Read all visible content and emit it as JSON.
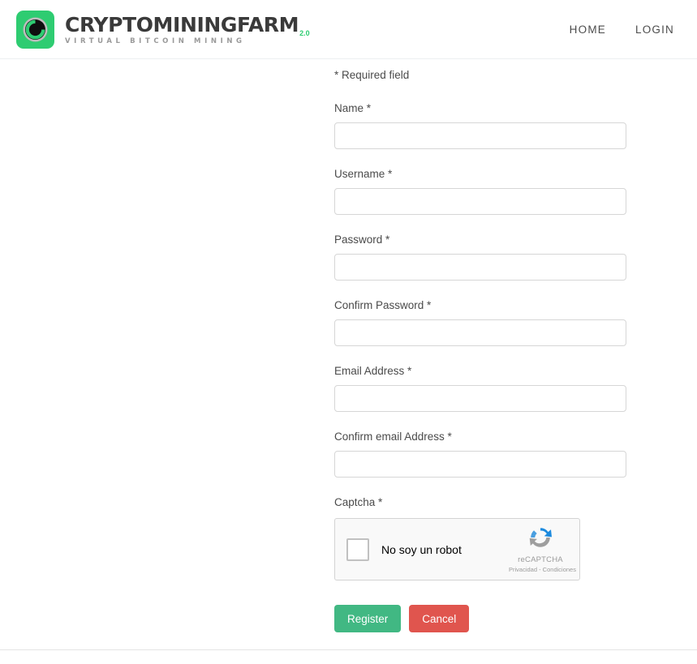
{
  "header": {
    "brand": {
      "name": "CRYPTOMININGFARM",
      "version": "2.0",
      "tagline": "VIRTUAL BITCOIN MINING",
      "logo_icon": "circle-emblem-icon",
      "logo_bg": "#2ecc71"
    },
    "nav": [
      {
        "label": "HOME",
        "name": "nav-link-home"
      },
      {
        "label": "LOGIN",
        "name": "nav-link-login"
      }
    ]
  },
  "form": {
    "required_note": "* Required field",
    "fields": [
      {
        "label": "Name *",
        "value": "",
        "placeholder": "",
        "type": "text",
        "name": "name"
      },
      {
        "label": "Username *",
        "value": "",
        "placeholder": "",
        "type": "text",
        "name": "username"
      },
      {
        "label": "Password *",
        "value": "",
        "placeholder": "",
        "type": "password",
        "name": "password"
      },
      {
        "label": "Confirm Password *",
        "value": "",
        "placeholder": "",
        "type": "password",
        "name": "confirm-password"
      },
      {
        "label": "Email Address *",
        "value": "",
        "placeholder": "",
        "type": "email",
        "name": "email"
      },
      {
        "label": "Confirm email Address *",
        "value": "",
        "placeholder": "",
        "type": "email",
        "name": "confirm-email"
      }
    ],
    "captcha": {
      "label": "Captcha *",
      "checkbox_label": "No soy un robot",
      "checked": false,
      "brand_name": "reCAPTCHA",
      "links": "Privacidad - Condiciones",
      "logo_icon": "recaptcha-arrows-icon"
    },
    "buttons": {
      "submit_label": "Register",
      "submit_color": "#41b883",
      "cancel_label": "Cancel",
      "cancel_color": "#e0554e"
    }
  }
}
